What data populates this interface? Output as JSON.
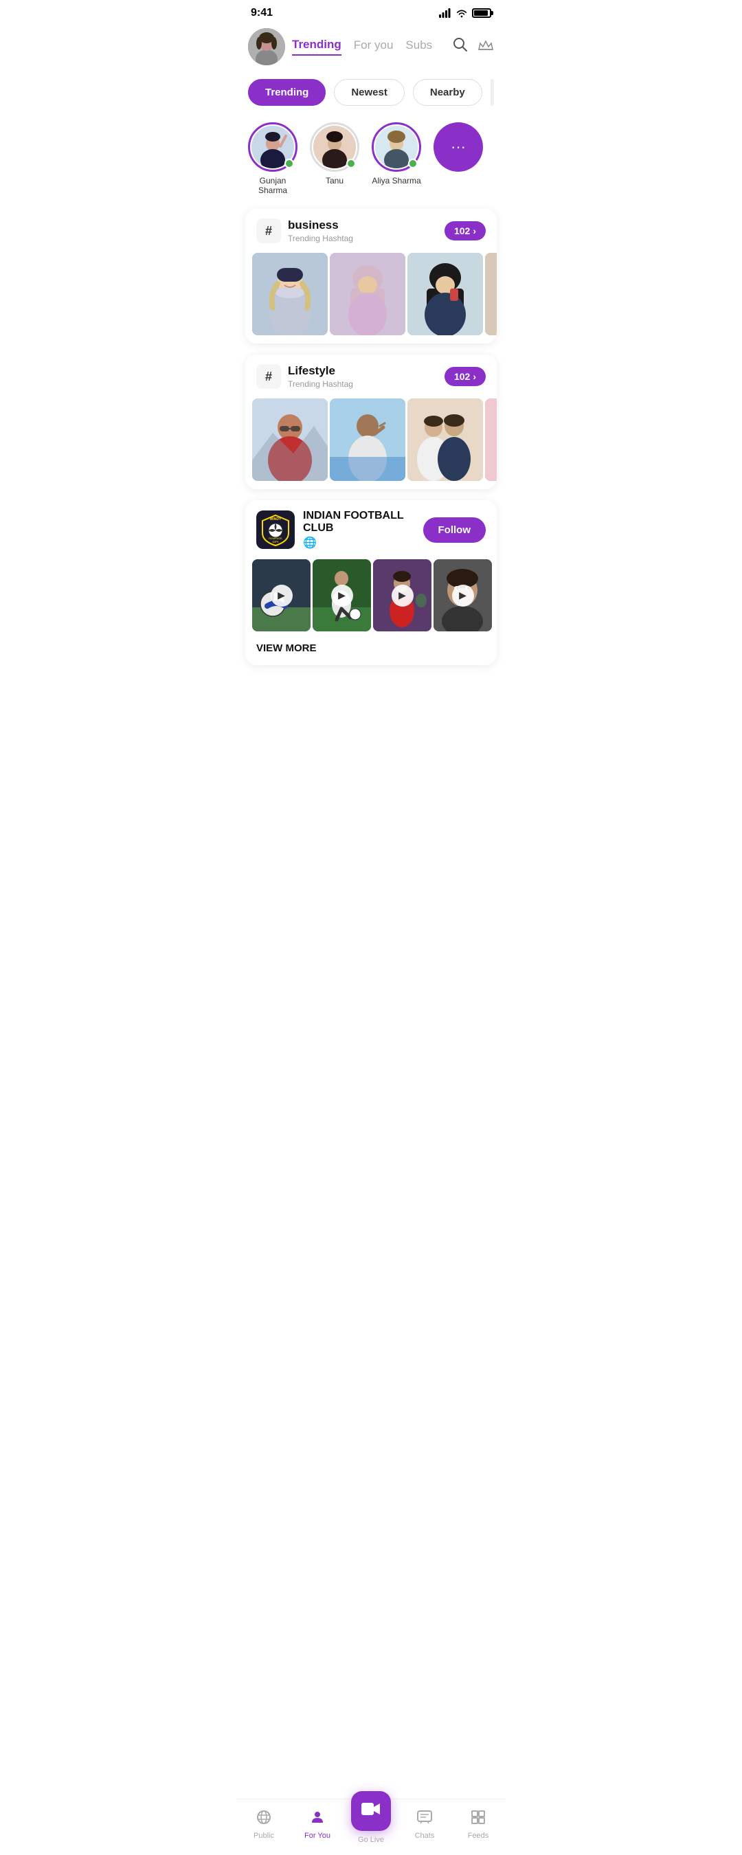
{
  "status": {
    "time": "9:41",
    "signal_icon": "signal",
    "wifi_icon": "wifi",
    "battery_icon": "battery"
  },
  "header": {
    "active_tab": "Trending",
    "tabs": [
      "Trending",
      "For you",
      "Subs"
    ],
    "search_icon": "search",
    "crown_icon": "crown"
  },
  "filters": {
    "items": [
      "Trending",
      "Newest",
      "Nearby"
    ],
    "active": "Trending",
    "more": "..."
  },
  "stories": {
    "items": [
      {
        "name": "Gunjan Sharma",
        "online": true
      },
      {
        "name": "Tanu",
        "online": true
      },
      {
        "name": "Aliya Sharma",
        "online": true
      }
    ],
    "more_icon": "···"
  },
  "hashtag_business": {
    "icon": "#",
    "title": "business",
    "subtitle": "Trending Hashtag",
    "count": "102",
    "chevron": "›"
  },
  "hashtag_lifestyle": {
    "icon": "#",
    "title": "Lifestyle",
    "subtitle": "Trending Hashtag",
    "count": "102",
    "chevron": "›"
  },
  "club": {
    "logo_text": "WINDY\ncity",
    "name": "INDIAN FOOTBALL CLUB",
    "globe_icon": "🌐",
    "follow_label": "Follow",
    "view_more": "VIEW MORE"
  },
  "bottom_nav": {
    "items": [
      {
        "icon": "📻",
        "label": "Public",
        "active": false
      },
      {
        "icon": "👤",
        "label": "For You",
        "active": true
      },
      {
        "icon": "🎥",
        "label": "Go Live",
        "active": false,
        "special": true
      },
      {
        "icon": "💬",
        "label": "Chats",
        "active": false
      },
      {
        "icon": "📋",
        "label": "Feeds",
        "active": false
      }
    ]
  }
}
